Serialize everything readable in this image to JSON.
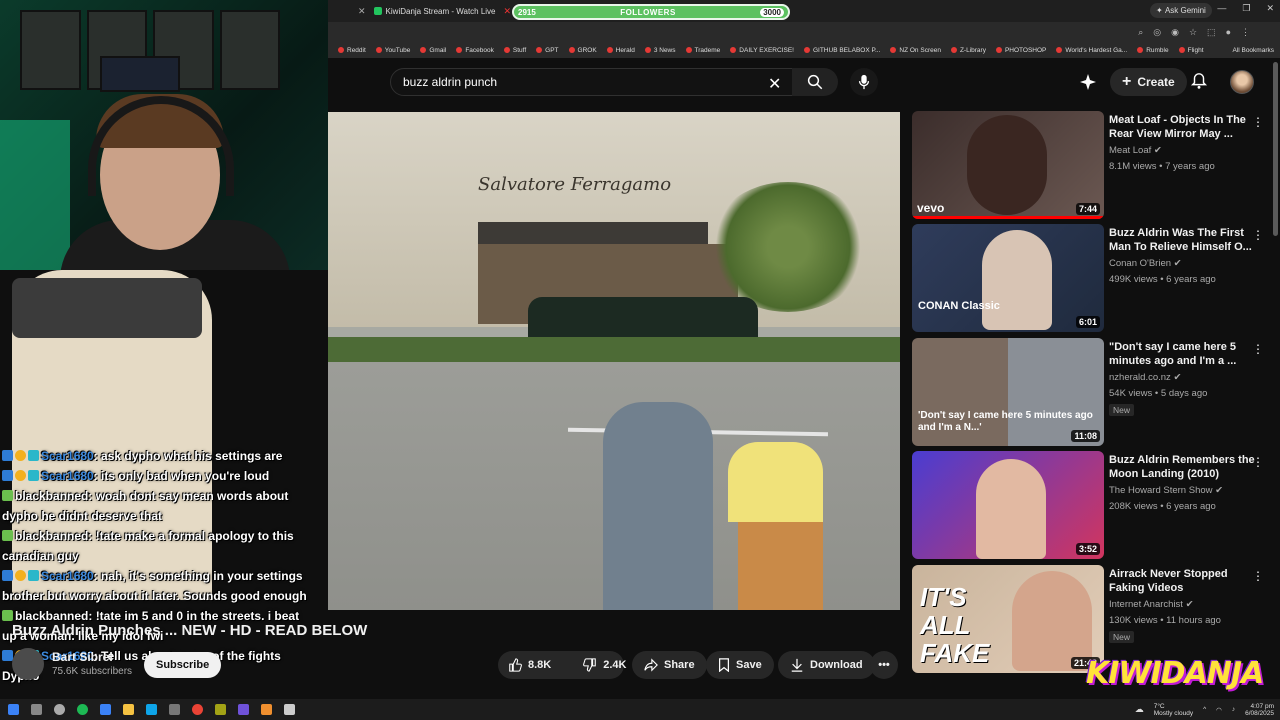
{
  "browser": {
    "tabs": [
      {
        "label": "KiwiDanja Stream - Watch Live"
      }
    ],
    "followers": {
      "start": "2915",
      "label": "FOLLOWERS",
      "end": "3000",
      "progress": 0.82
    },
    "gemini_label": "Ask Gemini",
    "bookmarks": [
      "Reddit",
      "YouTube",
      "Gmail",
      "Facebook",
      "Stuff",
      "GPT",
      "GROK",
      "Herald",
      "3 News",
      "Trademe",
      "DAILY EXERCISE!",
      "GITHUB BELABOX P...",
      "NZ On Screen",
      "Z-Library",
      "PHOTOSHOP",
      "World's Hardest Ga...",
      "Rumble",
      "Flight"
    ],
    "all_bookmarks": "All Bookmarks"
  },
  "youtube": {
    "search_value": "buzz aldrin punch",
    "create_label": "Create"
  },
  "video": {
    "title": "Buzz Aldrin Punches ... NEW - HD - READ BELOW",
    "channel_name": "Bart Sibrel",
    "subscribers": "75.6K subscribers",
    "subscribe_label": "Subscribe",
    "likes": "8.8K",
    "dislikes": "2.4K",
    "share_label": "Share",
    "save_label": "Save",
    "download_label": "Download",
    "sign_text": "Salvatore Ferragamo"
  },
  "chat": [
    {
      "user": "Scar1680",
      "text": ": ask dypho what his settings are",
      "color": "blue"
    },
    {
      "user": "Scar1680",
      "text": ": its only bad when you're loud",
      "color": "blue"
    },
    {
      "user": "blackbanned",
      "text": ": woah dont say mean words about dypho he didnt deserve that",
      "color": "white"
    },
    {
      "user": "blackbanned",
      "text": ": !tate make a formal apology to this canadian guy",
      "color": "white"
    },
    {
      "user": "Scar1680",
      "text": ": nah, it's something in your settings brother but worry about it later. Sounds good enough",
      "color": "blue"
    },
    {
      "user": "blackbanned",
      "text": ": !tate im 5 and 0 in the streets. i beat up a woman. like my idol fwi",
      "color": "white"
    },
    {
      "user": "Scar1680",
      "text": ": Tell us about some of the fights Dypho",
      "color": "blue"
    }
  ],
  "recommendations": [
    {
      "title": "Meat Loaf - Objects In The Rear View Mirror May ...",
      "channel": "Meat Loaf",
      "meta": "8.1M views • 7 years ago",
      "duration": "7:44",
      "overlay": "vevo",
      "new": ""
    },
    {
      "title": "Buzz Aldrin Was The First Man To Relieve Himself O...",
      "channel": "Conan O'Brien",
      "meta": "499K views • 6 years ago",
      "duration": "6:01",
      "overlay": "CONAN Classic",
      "new": ""
    },
    {
      "title": "\"Don't say I came here 5 minutes ago and I'm a ...",
      "channel": "nzherald.co.nz",
      "meta": "54K views • 5 days ago",
      "duration": "11:08",
      "overlay": "'Don't say I came here 5 minutes ago and I'm a N...'",
      "new": "New"
    },
    {
      "title": "Buzz Aldrin Remembers the Moon Landing (2010)",
      "channel": "The Howard Stern Show",
      "meta": "208K views • 6 years ago",
      "duration": "3:52",
      "overlay": "",
      "new": ""
    },
    {
      "title": "Airrack Never Stopped Faking Videos",
      "channel": "Internet Anarchist",
      "meta": "130K views • 11 hours ago",
      "duration": "21:42",
      "overlay": "IT'S ALL FAKE",
      "new": "New"
    }
  ],
  "overlay_logo": "KIWIDANJA",
  "taskbar": {
    "weather_temp": "7°C",
    "weather_desc": "Mostly cloudy",
    "time": "4:07 pm",
    "date": "6/08/2025"
  },
  "colors": {
    "accent_red": "#ff0000",
    "followers_green": "#5cc160",
    "bg": "#0f0f0f"
  }
}
